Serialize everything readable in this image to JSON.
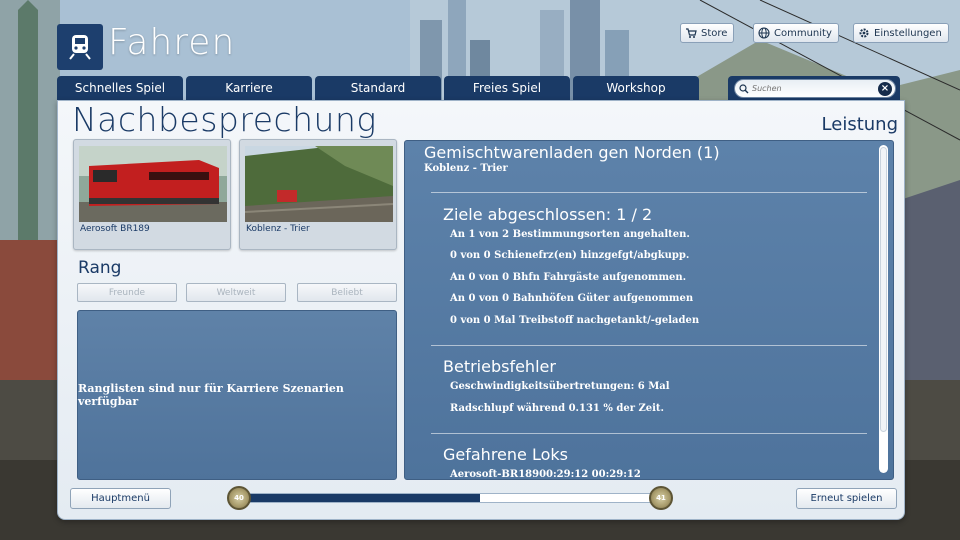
{
  "header": {
    "title": "Fahren",
    "store_label": "Store",
    "community_label": "Community",
    "settings_label": "Einstellungen"
  },
  "tabs": [
    {
      "label": "Schnelles Spiel"
    },
    {
      "label": "Karriere"
    },
    {
      "label": "Standard"
    },
    {
      "label": "Freies Spiel"
    },
    {
      "label": "Workshop"
    }
  ],
  "search": {
    "placeholder": "Suchen"
  },
  "page": {
    "title": "Nachbesprechung",
    "right_title": "Leistung"
  },
  "thumbnails": [
    {
      "label": "Aerosoft BR189"
    },
    {
      "label": "Koblenz - Trier"
    }
  ],
  "rank": {
    "title": "Rang",
    "filters": [
      "Freunde",
      "Weltweit",
      "Beliebt"
    ],
    "message": "Ranglisten sind nur für Karriere Szenarien verfügbar"
  },
  "scenario": {
    "title": "Gemischtwarenladen gen Norden (1)",
    "route": "Koblenz - Trier"
  },
  "goals": {
    "heading": "Ziele abgeschlossen: 1 / 2",
    "items": [
      "An 1 von 2 Bestimmungsorten angehalten.",
      "0 von 0 Schienefrz(en) hinzgefgt/abgkupp.",
      "An 0 von 0 Bhfn Fahrgäste aufgenommen.",
      "An 0 von 0 Bahnhöfen Güter aufgenommen",
      "0 von 0 Mal Treibstoff nachgetankt/-geladen"
    ]
  },
  "errors": {
    "heading": "Betriebsfehler",
    "items": [
      "Geschwindigkeitsübertretungen: 6 Mal",
      "Radschlupf während 0.131 % der Zeit."
    ]
  },
  "locos": {
    "heading": "Gefahrene Loks",
    "items": [
      "Aerosoft-BR18900:29:12      00:29:12"
    ]
  },
  "bottom": {
    "main_menu_label": "Hauptmenü",
    "replay_label": "Erneut spielen",
    "level_current": "40",
    "level_next": "41",
    "progress_fraction": 0.57
  },
  "colors": {
    "accent": "#1a3a66",
    "panel": "#4e739c"
  }
}
